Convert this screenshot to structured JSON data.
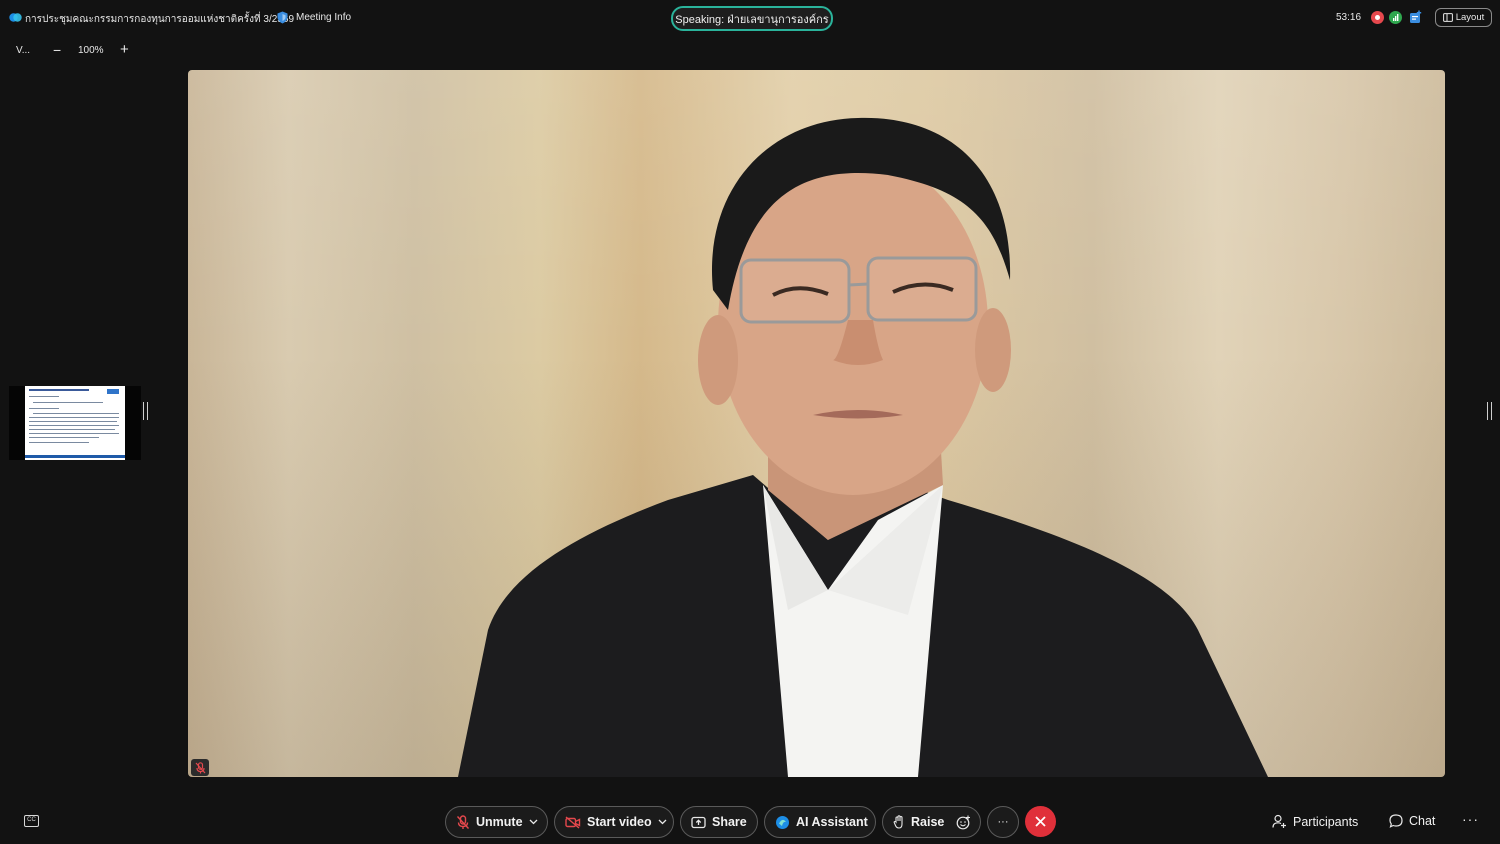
{
  "header": {
    "meeting_title": "การประชุมคณะกรรมการกองทุนการออมแห่งชาติครั้งที่ 3/2569",
    "meeting_info": "Meeting Info",
    "speaking": "Speaking: ฝ่ายเลขานุการองค์กร",
    "timer": "53:16",
    "layout_label": "Layout"
  },
  "view": {
    "label": "V...",
    "zoom_out": "−",
    "zoom_level": "100%",
    "zoom_in": "+"
  },
  "controls": {
    "unmute": "Unmute",
    "start_video": "Start video",
    "share": "Share",
    "ai_assistant": "AI Assistant",
    "raise": "Raise",
    "more": "···",
    "participants": "Participants",
    "chat": "Chat",
    "overflow": "···",
    "cc": "CC"
  },
  "colors": {
    "background": "#121212",
    "speaking_border": "#2ab39b",
    "end_call": "#e0303a",
    "muted_red": "#e5484d",
    "recording": "#e5484d",
    "connection": "#2fa84f"
  },
  "icons": [
    "webex-logo-icon",
    "shield-icon",
    "recording-icon",
    "connection-signal-icon",
    "notes-icon",
    "layout-icon",
    "mic-off-icon",
    "video-off-icon",
    "share-icon",
    "ai-assistant-icon",
    "raise-hand-icon",
    "reaction-icon",
    "end-call-icon",
    "participants-icon",
    "chat-icon",
    "closed-captions-icon"
  ]
}
